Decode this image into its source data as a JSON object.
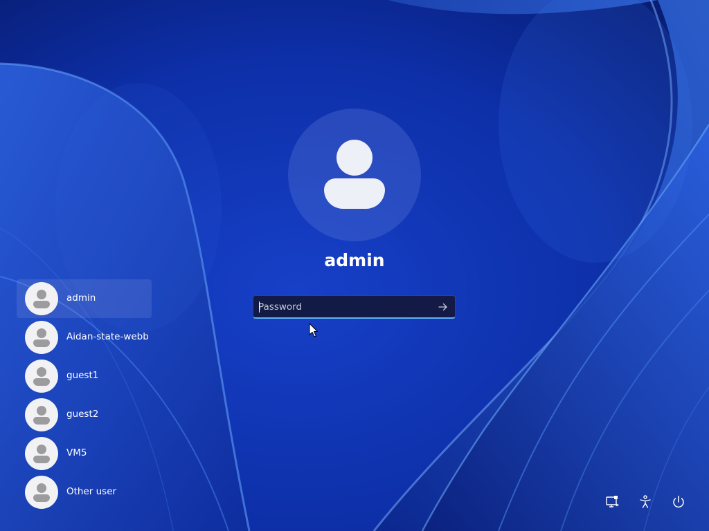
{
  "selected_user": {
    "name": "admin"
  },
  "password": {
    "value": "",
    "placeholder": "Password"
  },
  "user_list": [
    {
      "name": "admin",
      "selected": true
    },
    {
      "name": "Aidan-state-webb",
      "selected": false
    },
    {
      "name": "guest1",
      "selected": false
    },
    {
      "name": "guest2",
      "selected": false
    },
    {
      "name": "VM5",
      "selected": false
    },
    {
      "name": "Other user",
      "selected": false
    }
  ],
  "system_icons": {
    "network": "network-icon",
    "accessibility": "accessibility-icon",
    "power": "power-icon"
  },
  "colors": {
    "background": "#0a2a9e",
    "input_accent": "#5fb2f2",
    "text": "#ffffff"
  }
}
